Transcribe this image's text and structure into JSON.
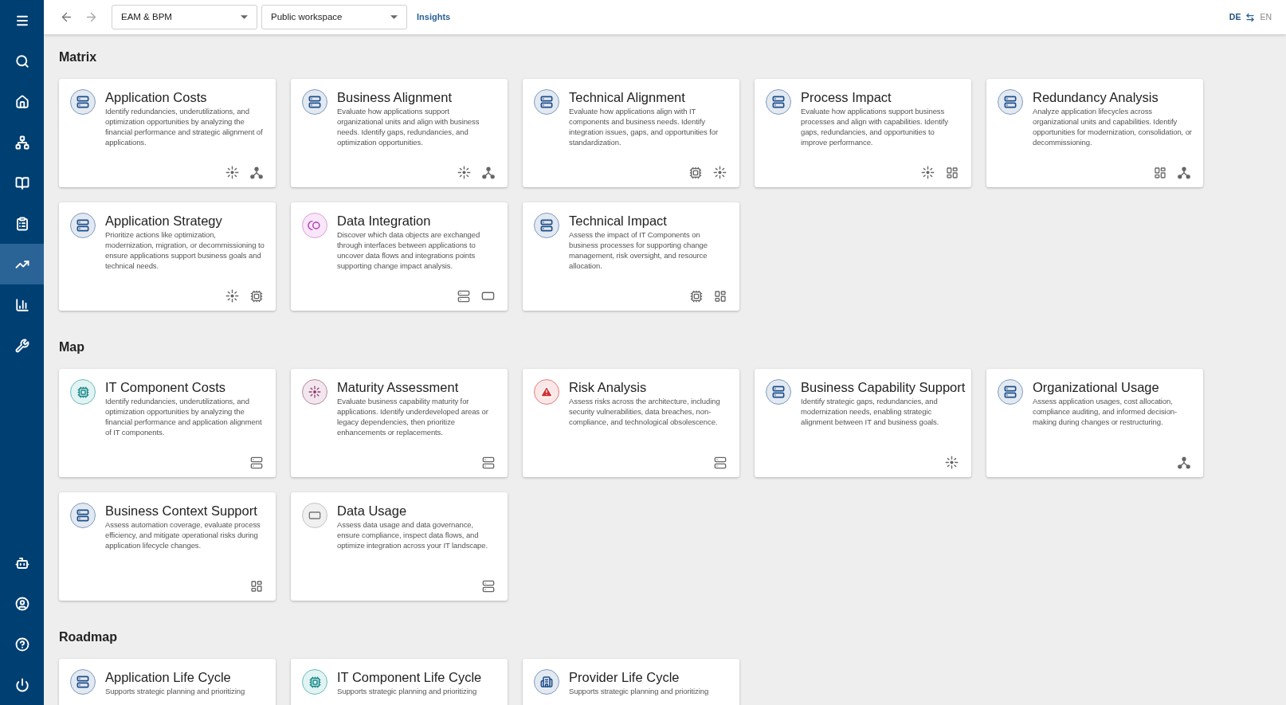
{
  "sidebar": {
    "top_items": [
      {
        "kind": "menu",
        "selected": false
      },
      {
        "kind": "search",
        "selected": false
      },
      {
        "kind": "home",
        "selected": false
      },
      {
        "kind": "hierarchy",
        "selected": false
      },
      {
        "kind": "book",
        "selected": false
      },
      {
        "kind": "clipboard",
        "selected": false
      },
      {
        "kind": "insights",
        "selected": true
      },
      {
        "kind": "chart",
        "selected": false
      },
      {
        "kind": "wrench",
        "selected": false
      }
    ],
    "bottom_items": [
      {
        "kind": "robot",
        "selected": false
      },
      {
        "kind": "account",
        "selected": false
      },
      {
        "kind": "help",
        "selected": false
      },
      {
        "kind": "power",
        "selected": false
      }
    ]
  },
  "topbar": {
    "dropdowns": [
      {
        "value": "EAM & BPM"
      },
      {
        "value": "Public workspace"
      }
    ],
    "link": "Insights",
    "languages": [
      {
        "label": "DE",
        "selected": true
      },
      {
        "label": "EN",
        "selected": false
      }
    ]
  },
  "sections": [
    {
      "title": "Matrix",
      "cards": [
        {
          "kind": "application",
          "title": "Application Costs",
          "description": "Identify redundancies, underutilizations, and optimization opportunities by analyzing the financial performance and strategic alignment of applications.",
          "footer_icons": [
            {
              "kind": "capability"
            },
            {
              "kind": "organization"
            }
          ]
        },
        {
          "kind": "application",
          "title": "Business Alignment",
          "description": "Evaluate how applications support organizational units and align with business needs. Identify gaps, redundancies, and optimization opportunities.",
          "footer_icons": [
            {
              "kind": "capability"
            },
            {
              "kind": "organization"
            }
          ]
        },
        {
          "kind": "application",
          "title": "Technical Alignment",
          "description": "Evaluate how applications align with IT components and business needs. Identify integration issues, gaps, and opportunities for standardization.",
          "footer_icons": [
            {
              "kind": "component"
            },
            {
              "kind": "capability"
            }
          ]
        },
        {
          "kind": "application",
          "title": "Process Impact",
          "description": "Evaluate how applications support business processes and align with capabilities. Identify gaps, redundancies, and opportunities to improve performance.",
          "footer_icons": [
            {
              "kind": "capability"
            },
            {
              "kind": "process"
            }
          ]
        },
        {
          "kind": "application",
          "title": "Redundancy Analysis",
          "description": "Analyze application lifecycles across organizational units and capabilities. Identify opportunities for modernization, consolidation, or decommissioning.",
          "footer_icons": [
            {
              "kind": "process"
            },
            {
              "kind": "organization"
            }
          ]
        },
        {
          "kind": "application",
          "title": "Application Strategy",
          "description": "Prioritize actions like optimization, modernization, migration, or decommissioning to ensure applications support business goals and technical needs.",
          "footer_icons": [
            {
              "kind": "capability"
            },
            {
              "kind": "component"
            }
          ]
        },
        {
          "kind": "interface",
          "title": "Data Integration",
          "description": "Discover which data objects are exchanged through interfaces between applications to uncover data flows and integrations points supporting change impact analysis.",
          "footer_icons": [
            {
              "kind": "application"
            },
            {
              "kind": "dataobject"
            }
          ]
        },
        {
          "kind": "application",
          "title": "Technical Impact",
          "description": "Assess the impact of IT Components on business processes for supporting change management, risk oversight, and resource allocation.",
          "footer_icons": [
            {
              "kind": "component"
            },
            {
              "kind": "process"
            }
          ]
        }
      ]
    },
    {
      "title": "Map",
      "cards": [
        {
          "kind": "component",
          "title": "IT Component Costs",
          "description": "Identify redundancies, underutilizations, and optimization opportunities by analyzing the financial performance and application alignment of IT components.",
          "footer_icons": [
            {
              "kind": "application"
            }
          ]
        },
        {
          "kind": "capability",
          "title": "Maturity Assessment",
          "description": "Evaluate business capability maturity for applications. Identify underdeveloped areas or legacy dependencies, then prioritize enhancements or replacements.",
          "footer_icons": [
            {
              "kind": "application"
            }
          ]
        },
        {
          "kind": "risk",
          "title": "Risk Analysis",
          "description": "Assess risks across the architecture, including security vulnerabilities, data breaches, non-compliance, and technological obsolescence.",
          "footer_icons": [
            {
              "kind": "application"
            }
          ]
        },
        {
          "kind": "application",
          "title": "Business Capability Support",
          "description": "Identify strategic gaps, redundancies, and modernization needs, enabling strategic alignment between IT and business goals.",
          "footer_icons": [
            {
              "kind": "capability"
            }
          ]
        },
        {
          "kind": "application",
          "title": "Organizational Usage",
          "description": "Assess application usages, cost allocation, compliance auditing, and informed decision-making during changes or restructuring.",
          "footer_icons": [
            {
              "kind": "organization"
            }
          ]
        },
        {
          "kind": "application",
          "title": "Business Context Support",
          "description": "Assess automation coverage, evaluate process efficiency, and mitigate operational risks during application lifecycle changes.",
          "footer_icons": [
            {
              "kind": "process"
            }
          ]
        },
        {
          "kind": "dataobject",
          "title": "Data Usage",
          "description": "Assess data usage and data governance, ensure compliance, inspect data flows, and optimize integration across your IT landscape.",
          "footer_icons": [
            {
              "kind": "application"
            }
          ]
        }
      ]
    },
    {
      "title": "Roadmap",
      "cards": [
        {
          "kind": "application",
          "title": "Application Life Cycle",
          "description": "Supports strategic planning and prioritizing"
        },
        {
          "kind": "component",
          "title": "IT Component Life Cycle",
          "description": "Supports strategic planning and prioritizing"
        },
        {
          "kind": "provider",
          "title": "Provider Life Cycle",
          "description": "Supports strategic planning and prioritizing"
        }
      ]
    }
  ]
}
